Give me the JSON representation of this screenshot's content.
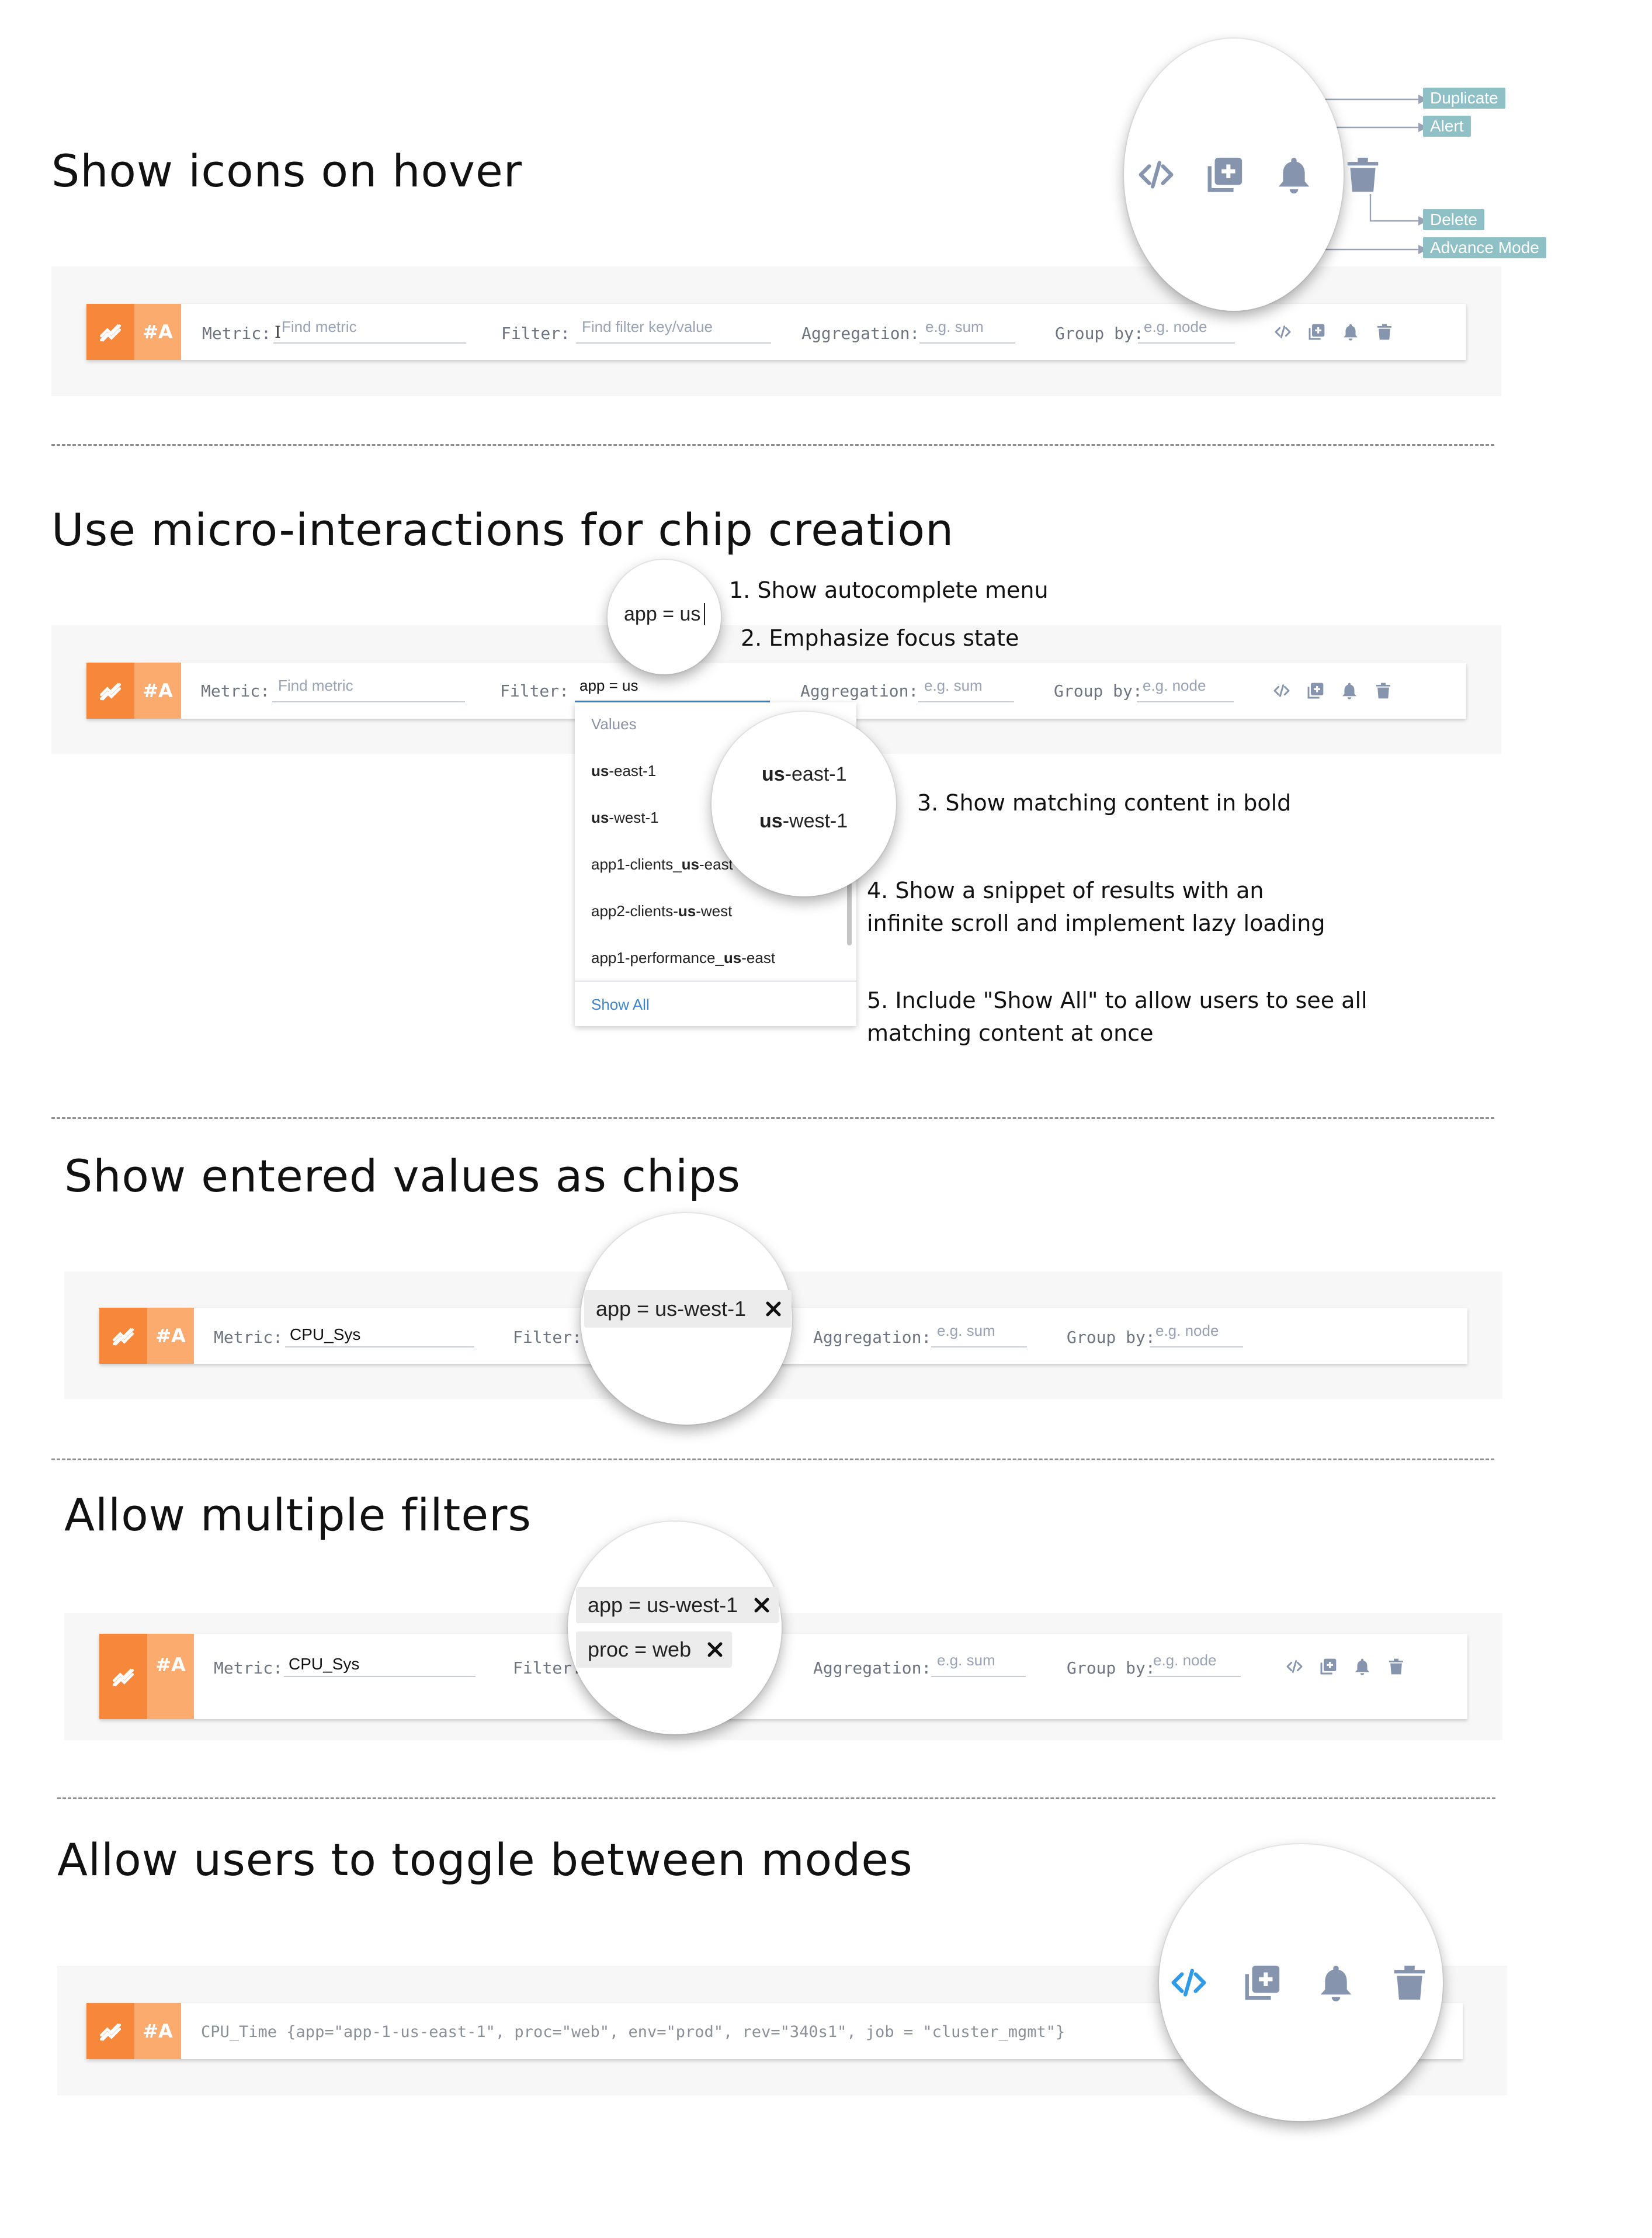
{
  "sections": [
    {
      "title": "Show icons on hover"
    },
    {
      "title": "Use micro-interactions for chip creation"
    },
    {
      "title": "Show entered values as chips"
    },
    {
      "title": "Allow multiple filters"
    },
    {
      "title": "Allow users to toggle between modes"
    }
  ],
  "query_row": {
    "tag_label": "#A",
    "metric_label": "Metric:",
    "metric_placeholder": "Find metric",
    "filter_label": "Filter:",
    "filter_placeholder": "Find filter key/value",
    "aggregation_label": "Aggregation:",
    "aggregation_placeholder": "e.g. sum",
    "groupby_label": "Group by:",
    "groupby_placeholder": "e.g. node",
    "cursor_glyph": "I"
  },
  "callouts": {
    "duplicate": "Duplicate",
    "alert": "Alert",
    "delete": "Delete",
    "advance_mode": "Advance Mode"
  },
  "autocomplete": {
    "typed_value": "app = us",
    "header": "Values",
    "items": [
      {
        "pre": "",
        "bold": "us",
        "post": "-east-1"
      },
      {
        "pre": "",
        "bold": "us",
        "post": "-west-1"
      },
      {
        "pre": "app1-clients_",
        "bold": "us",
        "post": "-east"
      },
      {
        "pre": "app2-clients-",
        "bold": "us",
        "post": "-west"
      },
      {
        "pre": "app1-performance_",
        "bold": "us",
        "post": "-east"
      }
    ],
    "show_all": "Show All",
    "zoom_items": [
      {
        "bold": "us",
        "post": "-east-1"
      },
      {
        "bold": "us",
        "post": "-west-1"
      }
    ],
    "notes": [
      "1. Show autocomplete menu",
      "2. Emphasize focus state",
      "3. Show matching content in bold",
      "4. Show a snippet of results with an infinite scroll and implement lazy loading",
      "5. Include \"Show All\" to allow users to see all matching content at once"
    ]
  },
  "chips_section": {
    "metric_value": "CPU_Sys",
    "chip_1": "app = us-west-1",
    "chip_2": "proc = web"
  },
  "advanced_mode": {
    "query_text": "CPU_Time {app=\"app-1-us-east-1\", proc=\"web\", env=\"prod\", rev=\"340s1\", job = \"cluster_mgmt\"}"
  },
  "colors": {
    "tag_dark": "#f7873b",
    "tag_light": "#fbab6d",
    "icon_gray": "#8695ad",
    "callout": "#8fc0c6",
    "accent_blue": "#2f9be6",
    "link_blue": "#3c84c9"
  },
  "icons": [
    "chart-icon",
    "code-icon",
    "duplicate-icon",
    "bell-icon",
    "trash-icon",
    "close-icon"
  ]
}
